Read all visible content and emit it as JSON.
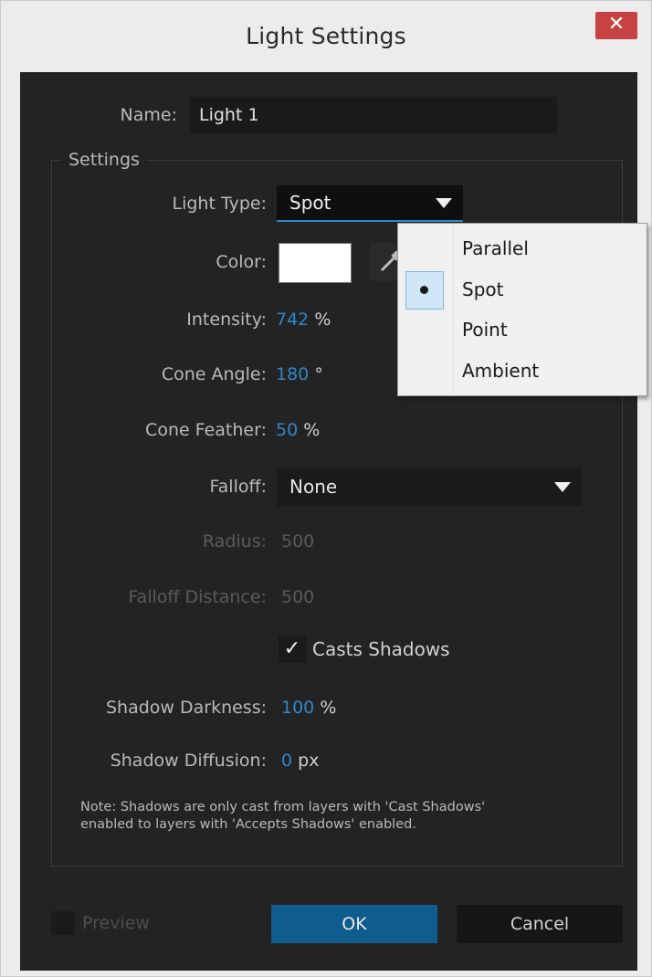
{
  "window": {
    "title": "Light Settings",
    "close_glyph": "✕"
  },
  "name": {
    "label": "Name:",
    "value": "Light 1"
  },
  "settings": {
    "legend": "Settings",
    "light_type": {
      "label": "Light Type:",
      "value": "Spot"
    },
    "color": {
      "label": "Color:",
      "swatch": "#ffffff"
    },
    "intensity": {
      "label": "Intensity:",
      "value": "742",
      "unit": "%"
    },
    "cone_angle": {
      "label": "Cone Angle:",
      "value": "180",
      "unit": "°"
    },
    "cone_feather": {
      "label": "Cone Feather:",
      "value": "50",
      "unit": "%"
    },
    "falloff": {
      "label": "Falloff:",
      "value": "None"
    },
    "radius": {
      "label": "Radius:",
      "value": "500"
    },
    "falloff_distance": {
      "label": "Falloff Distance:",
      "value": "500"
    },
    "casts_shadows": {
      "check": "✓",
      "label": "Casts Shadows"
    },
    "shadow_darkness": {
      "label": "Shadow Darkness:",
      "value": "100",
      "unit": "%"
    },
    "shadow_diffusion": {
      "label": "Shadow Diffusion:",
      "value": "0",
      "unit": "px"
    },
    "note_line1": "Note: Shadows are only cast from layers with 'Cast Shadows'",
    "note_line2": "enabled to layers with 'Accepts Shadows' enabled."
  },
  "footer": {
    "preview": "Preview",
    "ok": "OK",
    "cancel": "Cancel"
  },
  "menu": {
    "items": [
      "Parallel",
      "Spot",
      "Point",
      "Ambient"
    ],
    "selected": "Spot"
  },
  "colors": {
    "accent": "#2f86c9",
    "ok_bg": "#0f5c8e",
    "panel_bg": "#232323",
    "close_bg": "#c74343"
  }
}
